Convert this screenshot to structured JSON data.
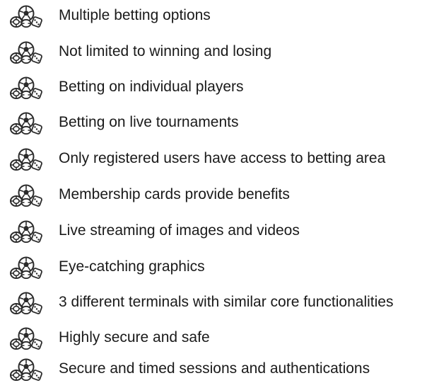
{
  "features": {
    "icon": "soccer-ball-with-chips-and-dice-icon",
    "icon_color": "#2b2b2b",
    "text_color": "#1a1a1a",
    "items": [
      {
        "label": "Multiple betting options"
      },
      {
        "label": "Not limited to winning and losing"
      },
      {
        "label": "Betting on individual players"
      },
      {
        "label": "Betting on live tournaments"
      },
      {
        "label": "Only registered users have access to betting area"
      },
      {
        "label": "Membership cards provide benefits"
      },
      {
        "label": "Live streaming of images and videos"
      },
      {
        "label": "Eye-catching graphics"
      },
      {
        "label": "3 different terminals with similar core functionalities"
      },
      {
        "label": "Highly secure and safe"
      },
      {
        "label": "Secure and timed sessions and authentications"
      }
    ]
  }
}
